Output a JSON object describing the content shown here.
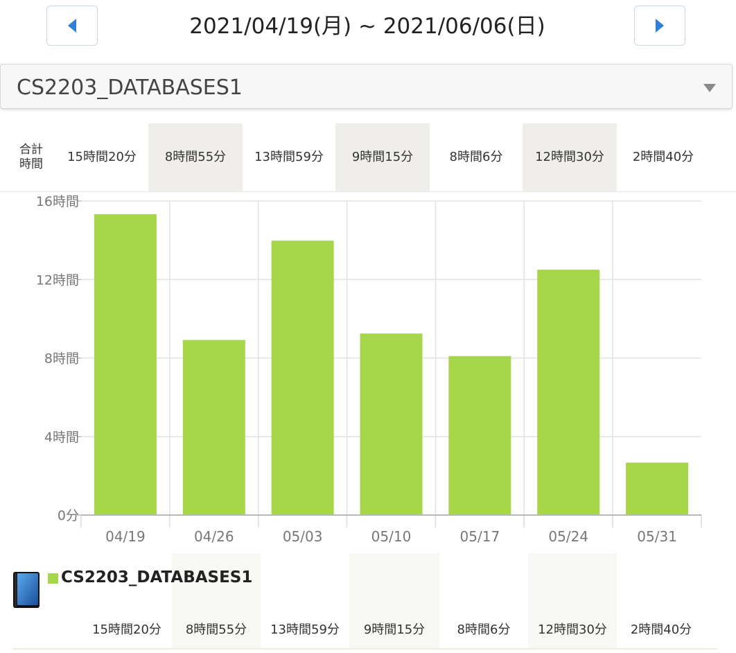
{
  "header": {
    "date_range": "2021/04/19(月) ~ 2021/06/06(日)",
    "prev_icon": "triangle-left-icon",
    "next_icon": "triangle-right-icon",
    "accent_color": "#2f7fd6"
  },
  "course_select": {
    "selected": "CS2203_DATABASES1",
    "caret_icon": "triangle-down-icon"
  },
  "totals": {
    "label_line1": "合計",
    "label_line2": "時間",
    "values": [
      "15時間20分",
      "8時間55分",
      "13時間59分",
      "9時間15分",
      "8時間6分",
      "12時間30分",
      "2時間40分"
    ]
  },
  "course_breakdown": {
    "icon": "book-icon",
    "name": "CS2203_DATABASES1",
    "values": [
      "15時間20分",
      "8時間55分",
      "13時間59分",
      "9時間15分",
      "8時間6分",
      "12時間30分",
      "2時間40分"
    ]
  },
  "chart_data": {
    "type": "bar",
    "categories": [
      "04/19",
      "04/26",
      "05/03",
      "05/10",
      "05/17",
      "05/24",
      "05/31"
    ],
    "series": [
      {
        "name": "CS2203_DATABASES1",
        "values": [
          15.33,
          8.92,
          13.98,
          9.25,
          8.1,
          12.5,
          2.67
        ],
        "color": "#a6d64a"
      }
    ],
    "ylim": [
      0,
      16
    ],
    "yticks": [
      0,
      4,
      8,
      12,
      16
    ],
    "ytick_labels": [
      "0分",
      "4時間",
      "8時間",
      "12時間",
      "16時間"
    ],
    "grid": true
  }
}
